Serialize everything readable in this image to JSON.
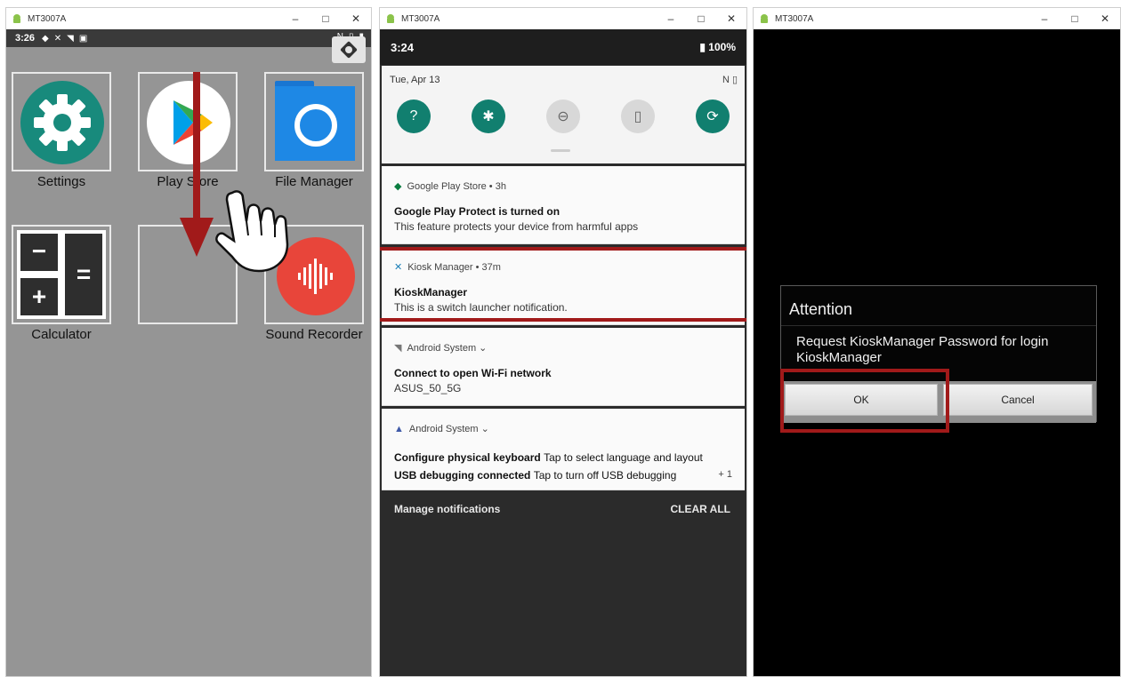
{
  "window_title": "MT3007A",
  "win_controls": {
    "minimize": "–",
    "maximize": "□",
    "close": "✕"
  },
  "win1": {
    "status_time": "3:26",
    "apps": [
      {
        "label": "Settings",
        "icon": "gear-icon"
      },
      {
        "label": "Play Store",
        "icon": "play-store-icon"
      },
      {
        "label": "File Manager",
        "icon": "folder-icon"
      },
      {
        "label": "Calculator",
        "icon": "calculator-icon"
      },
      {
        "label": "",
        "icon": "empty-slot"
      },
      {
        "label": "Sound Recorder",
        "icon": "microphone-wave-icon"
      }
    ],
    "calc_keys": {
      "minus": "−",
      "equals": "=",
      "plus": "+"
    }
  },
  "win2": {
    "status_time": "3:24",
    "battery": "100%",
    "qs_date": "Tue, Apr 13",
    "qs_tiles": [
      "wifi-question-icon",
      "bluetooth-icon",
      "dnd-icon",
      "flashlight-icon",
      "autorotate-icon"
    ],
    "notifications": [
      {
        "app": "Google Play Store • 3h",
        "title": "Google Play Protect is turned on",
        "text": "This feature protects your device from harmful apps"
      },
      {
        "app": "Kiosk Manager • 37m",
        "title": "KioskManager",
        "text": "This is a switch launcher notification."
      },
      {
        "app": "Android System ⌄",
        "title": "Connect to open Wi-Fi network",
        "text": "ASUS_50_5G"
      },
      {
        "app": "Android System ⌄",
        "title": "Configure physical keyboard",
        "title_tail": "Tap to select language and layout",
        "title2": "USB debugging connected",
        "title2_tail": "Tap to turn off USB debugging",
        "extra": "+ 1"
      }
    ],
    "manage_label": "Manage notifications",
    "clear_label": "CLEAR ALL"
  },
  "win3": {
    "dialog_title": "Attention",
    "dialog_message": "Request KioskManager Password for login KioskManager",
    "ok_label": "OK",
    "cancel_label": "Cancel"
  },
  "colors": {
    "highlight": "#a11a1a",
    "teal": "#188a7c"
  }
}
